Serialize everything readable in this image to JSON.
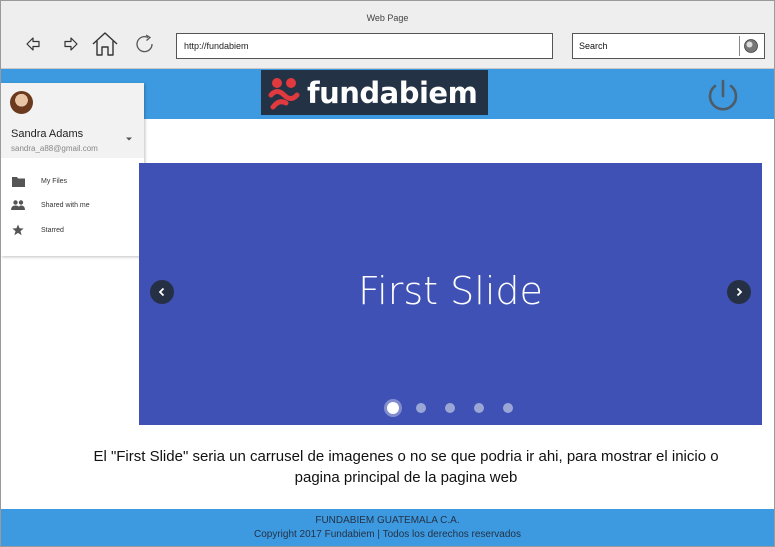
{
  "window": {
    "title": "Web Page"
  },
  "browser": {
    "url": "http://fundabiem",
    "search_placeholder": "Search"
  },
  "header": {
    "logo_text": "fundabiem",
    "accent": "#3d9ae0",
    "logo_bg": "#243246"
  },
  "drawer": {
    "user_name": "Sandra Adams",
    "user_email": "sandra_a88@gmail.com",
    "items": [
      {
        "label": "My Files",
        "icon": "folder-icon"
      },
      {
        "label": "Shared with me",
        "icon": "people-icon"
      },
      {
        "label": "Starred",
        "icon": "star-icon"
      }
    ]
  },
  "carousel": {
    "slide_title": "First Slide",
    "slide_bg": "#3f51b5",
    "slide_count": 5,
    "active_index": 0
  },
  "caption": {
    "line1": "El \"First Slide\" seria un carrusel de imagenes o no se que podria ir ahi, para mostrar el inicio o",
    "line2": "pagina principal de la pagina web"
  },
  "footer": {
    "line1": "FUNDABIEM  GUATEMALA C.A.",
    "line2": "Copyright 2017 Fundabiem |  Todos los derechos reservados"
  }
}
